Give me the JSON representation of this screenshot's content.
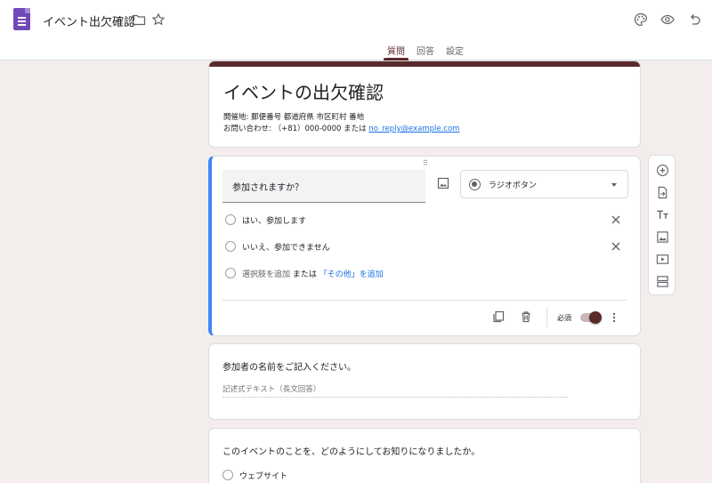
{
  "header": {
    "doc_title": "イベント出欠確認",
    "icons": [
      "forms-app-icon",
      "folder-icon",
      "star-icon",
      "palette-icon",
      "preview-eye-icon",
      "undo-icon"
    ]
  },
  "tabs": [
    {
      "label": "質問",
      "active": true
    },
    {
      "label": "回答",
      "active": false
    },
    {
      "label": "設定",
      "active": false
    }
  ],
  "form": {
    "title": "イベントの出欠確認",
    "description_line1": "開催地: 郵便番号 都道府県 市区町村 番地",
    "description_line2_prefix": "お問い合わせ: （+81）000-0000 または ",
    "contact_email": "no_reply@example.com"
  },
  "active_question": {
    "title": "参加されますか？",
    "type_label": "ラジオボタン",
    "options": [
      "はい、参加します",
      "いいえ、参加できません"
    ],
    "add_option": "選択肢を追加",
    "or_text": "または",
    "add_other": "「その他」を追加",
    "required_label": "必須",
    "required": true
  },
  "question2": {
    "title": "参加者の名前をご記入ください。",
    "placeholder": "記述式テキスト（長文回答）"
  },
  "question3": {
    "title": "このイベントのことを、どのようにしてお知りになりましたか。",
    "options": [
      "ウェブサイト"
    ]
  },
  "sidetools": [
    "add-question-icon",
    "import-questions-icon",
    "add-title-icon",
    "add-image-icon",
    "add-video-icon",
    "add-section-icon"
  ],
  "colors": {
    "accent": "#5a2a2a",
    "active_border": "#4285f4",
    "link": "#1a73e8",
    "background": "#f3eeec",
    "app_icon": "#7248b9"
  }
}
